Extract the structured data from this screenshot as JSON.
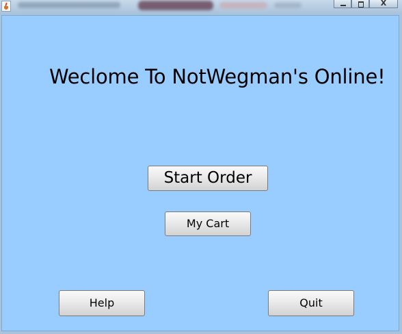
{
  "window": {
    "content_background": "#99ccff",
    "controls": {
      "minimize_icon": "minimize-icon",
      "maximize_icon": "maximize-icon",
      "close_icon": "close-icon",
      "close_label": "X"
    }
  },
  "main": {
    "welcome_text": "Weclome To NotWegman's Online!",
    "start_order_label": "Start Order",
    "my_cart_label": "My Cart",
    "help_label": "Help",
    "quit_label": "Quit"
  }
}
